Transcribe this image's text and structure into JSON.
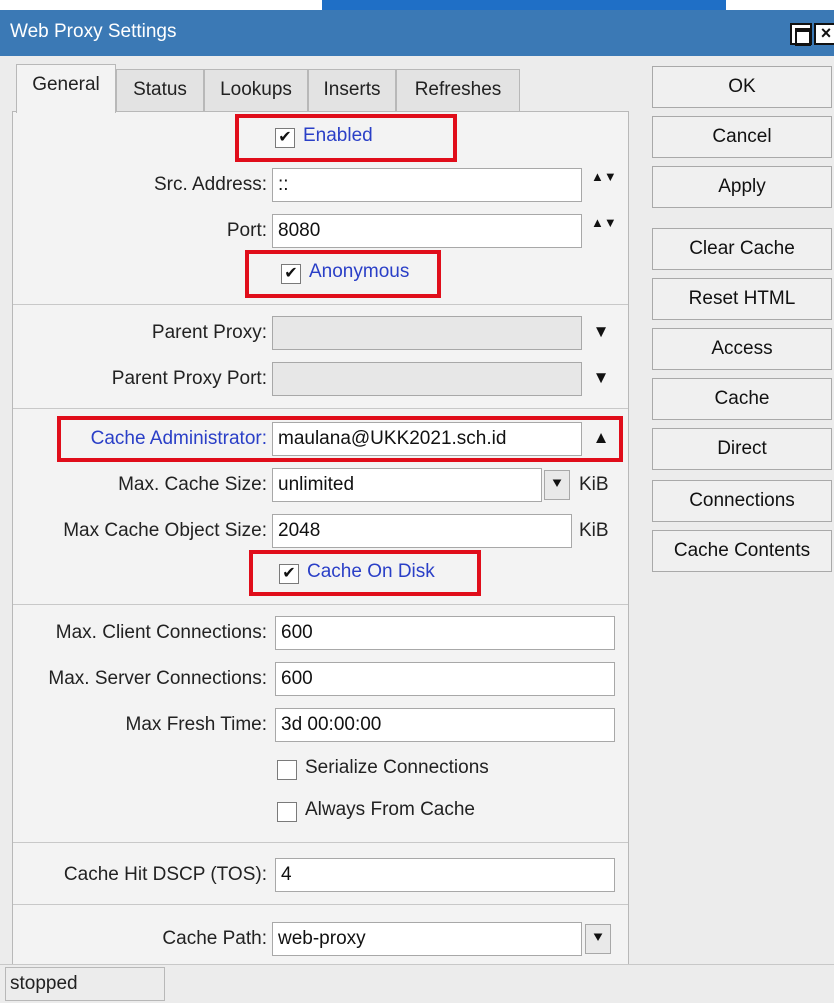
{
  "window": {
    "title": "Web Proxy Settings",
    "maximize_glyph": "",
    "close_glyph": "×"
  },
  "tabs": [
    "General",
    "Status",
    "Lookups",
    "Inserts",
    "Refreshes"
  ],
  "active_tab": "General",
  "general": {
    "enabled": {
      "label": "Enabled",
      "checked": true
    },
    "src_address": {
      "label": "Src. Address:",
      "value": "::"
    },
    "port": {
      "label": "Port:",
      "value": "8080"
    },
    "anonymous": {
      "label": "Anonymous",
      "checked": true
    },
    "parent_proxy": {
      "label": "Parent Proxy:",
      "value": ""
    },
    "parent_proxy_port": {
      "label": "Parent Proxy Port:",
      "value": ""
    },
    "cache_administrator": {
      "label": "Cache Administrator:",
      "value": "maulana@UKK2021.sch.id"
    },
    "max_cache_size": {
      "label": "Max. Cache Size:",
      "value": "unlimited",
      "unit": "KiB"
    },
    "max_cache_object_size": {
      "label": "Max Cache Object Size:",
      "value": "2048",
      "unit": "KiB"
    },
    "cache_on_disk": {
      "label": "Cache On Disk",
      "checked": true
    },
    "max_client_connections": {
      "label": "Max. Client Connections:",
      "value": "600"
    },
    "max_server_connections": {
      "label": "Max. Server Connections:",
      "value": "600"
    },
    "max_fresh_time": {
      "label": "Max Fresh Time:",
      "value": "3d 00:00:00"
    },
    "serialize_connections": {
      "label": "Serialize Connections",
      "checked": false
    },
    "always_from_cache": {
      "label": "Always From Cache",
      "checked": false
    },
    "cache_hit_dscp": {
      "label": "Cache Hit DSCP (TOS):",
      "value": "4"
    },
    "cache_path": {
      "label": "Cache Path:",
      "value": "web-proxy"
    }
  },
  "glyphs": {
    "check": "✔",
    "spin": "▲▼",
    "down": "▼",
    "up": "▲",
    "dropdown": "⯆"
  },
  "buttons": [
    "OK",
    "Cancel",
    "Apply",
    "Clear Cache",
    "Reset HTML",
    "Access",
    "Cache",
    "Direct",
    "Connections",
    "Cache Contents"
  ],
  "status": "stopped",
  "colors": {
    "titlebar": "#3b79b5",
    "highlight": "#e00d1a",
    "blue_label": "#2a3fc7"
  }
}
